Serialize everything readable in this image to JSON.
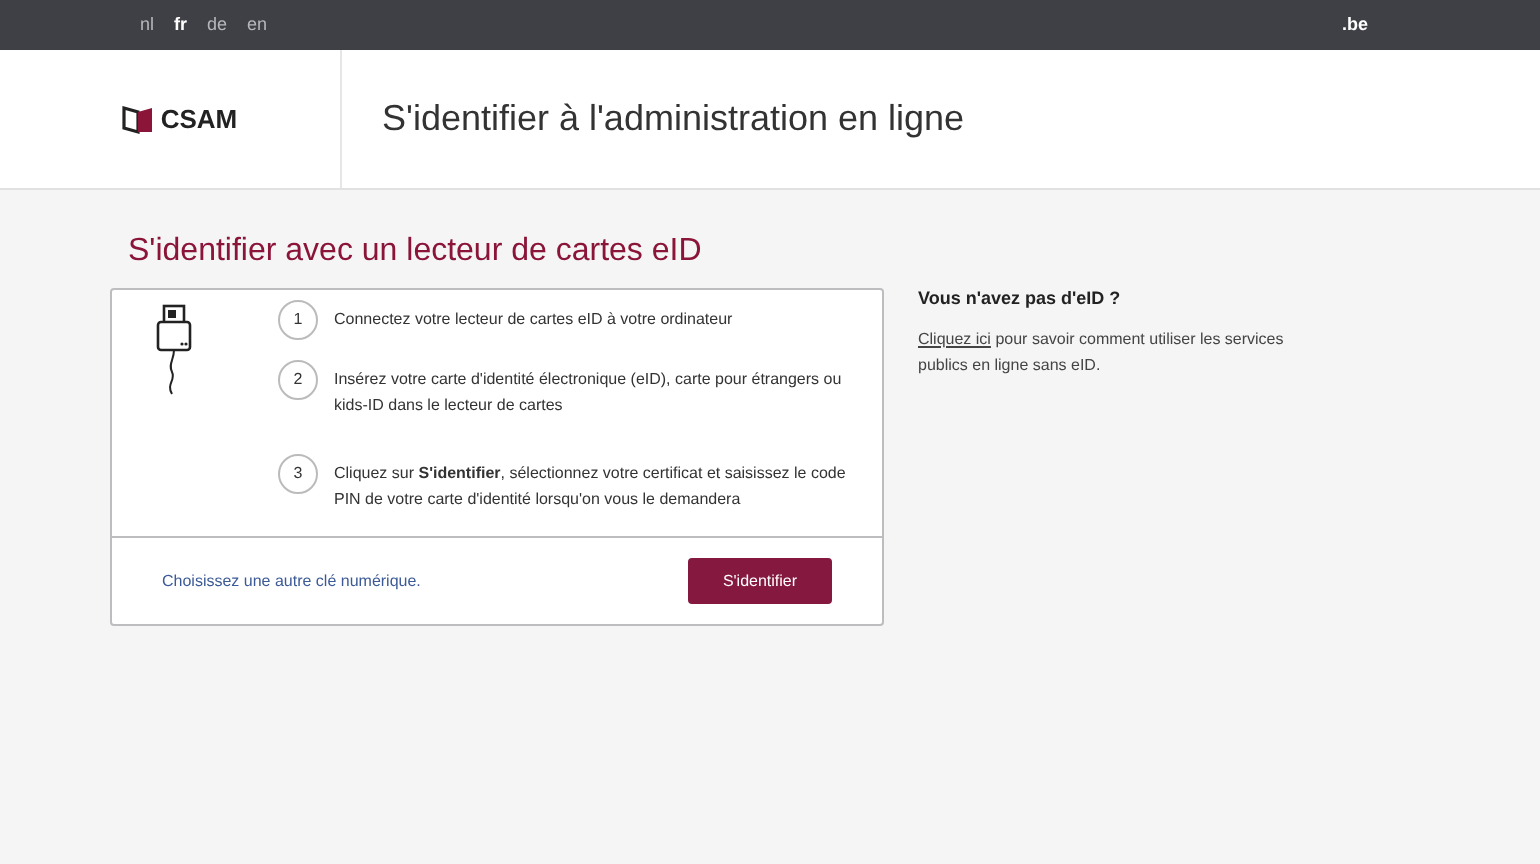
{
  "top_bar": {
    "languages": [
      {
        "label": "nl",
        "selected": false
      },
      {
        "label": "fr",
        "selected": true
      },
      {
        "label": "de",
        "selected": false
      },
      {
        "label": "en",
        "selected": false
      }
    ],
    "domain": ".be"
  },
  "header": {
    "logo": "CSAM",
    "title": "S'identifier à l'administration en ligne"
  },
  "main": {
    "heading": "S'identifier avec un lecteur de cartes eID",
    "steps": [
      {
        "number": "1",
        "text": "Connectez votre lecteur de cartes eID à votre ordinateur"
      },
      {
        "number": "2",
        "text": "Insérez votre carte d'identité électronique (eID), carte pour étrangers ou kids-ID dans le lecteur de cartes"
      },
      {
        "number": "3",
        "text": "Cliquez sur **S'identifier**, sélectionnez votre certificat et saisissez le code PIN de votre carte d'identité lorsqu'on vous le demandera"
      }
    ],
    "other_key_link": "Choisissez une autre clé numérique.",
    "login_button": "S'identifier"
  },
  "aside": {
    "title": "Vous n'avez pas d'eID ?",
    "link": "Cliquez ici",
    "text": "pour savoir comment utiliser les services publics en ligne sans eID."
  }
}
